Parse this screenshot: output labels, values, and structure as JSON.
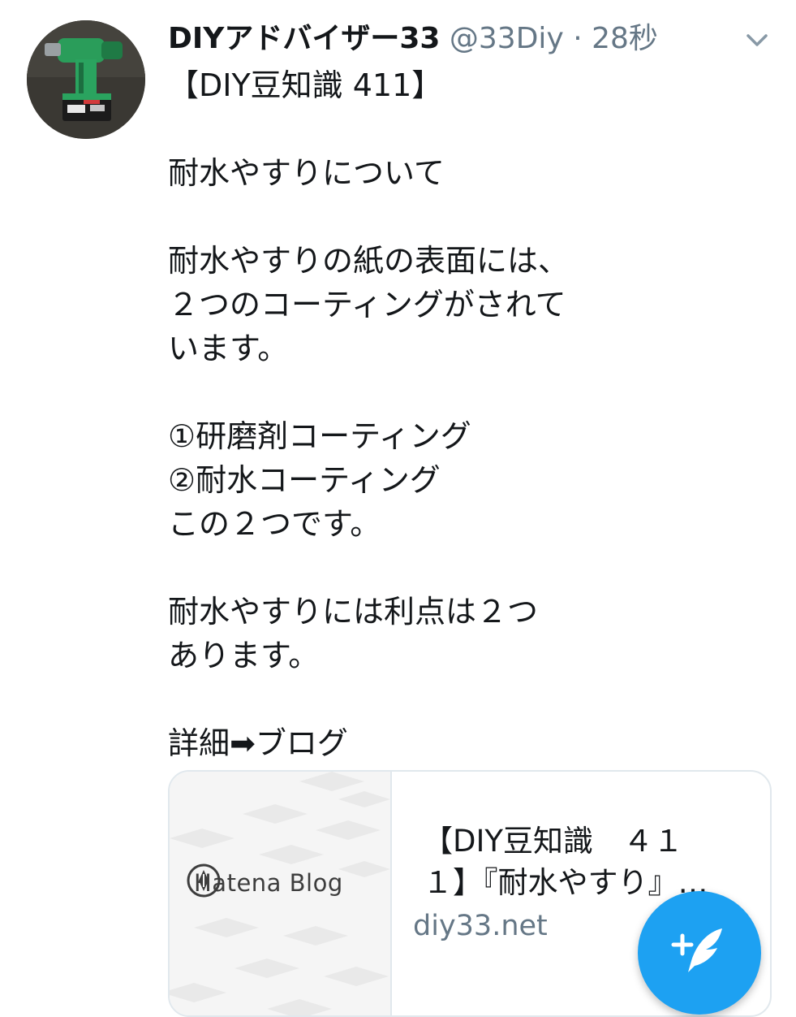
{
  "tweet": {
    "author_name": "DIYアドバイザー33",
    "handle": "@33Diy",
    "separator": "·",
    "time": "28秒",
    "avatar_icon": "impact-driver-photo",
    "menu_icon": "chevron-down-icon",
    "lines": [
      "【DIY豆知識 411】",
      "",
      "耐水やすりについて",
      "",
      "耐水やすりの紙の表面には、",
      "２つのコーティングがされて",
      "います。",
      "",
      "①研磨剤コーティング",
      "②耐水コーティング",
      "この２つです。",
      "",
      "耐水やすりには利点は２つ",
      "あります。",
      "",
      "詳細➡ブログ"
    ]
  },
  "link_card": {
    "thumbnail_brand": "Hatena Blog",
    "thumbnail_icon": "hatena-pen-icon",
    "title_lines": [
      "【DIY豆知識　４１",
      "１】『耐水やすり』…"
    ],
    "domain": "diy33.net"
  },
  "compose_button": {
    "icon": "compose-feather-icon"
  },
  "colors": {
    "text": "#14171a",
    "secondary": "#657786",
    "accent": "#1da1f2",
    "border": "#e1e8ed"
  }
}
